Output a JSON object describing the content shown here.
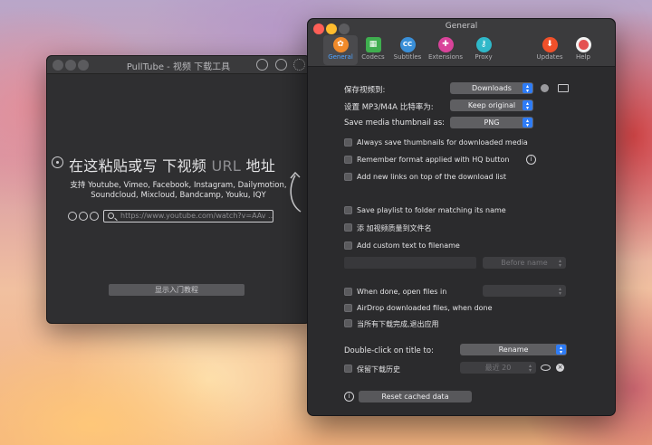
{
  "pulltube": {
    "title": "PullTube - 视频 下载工具",
    "heading_main": "在这粘贴或写 下视频",
    "heading_url": "URL",
    "heading_end": "地址",
    "support_line1": "支持 Youtube, Vimeo, Facebook, Instagram, Dailymotion,",
    "support_line2": "Soundcloud, Mixcloud, Bandcamp, Youku, IQY",
    "url_placeholder": "https://www.youtube.com/watch?v=AAv ...",
    "tutorial_button": "显示入门教程"
  },
  "general": {
    "title": "General",
    "tabs": [
      {
        "label": "General",
        "icon": "gear-icon",
        "color": "#f08a2a"
      },
      {
        "label": "Codecs",
        "icon": "film-icon",
        "color": "#3fae4f"
      },
      {
        "label": "Subtitles",
        "icon": "cc-icon",
        "color": "#3a8fd8"
      },
      {
        "label": "Extensions",
        "icon": "puzzle-icon",
        "color": "#d9439a"
      },
      {
        "label": "Proxy",
        "icon": "key-icon",
        "color": "#2fb8c9"
      },
      {
        "label": "Updates",
        "icon": "download-arrow-icon",
        "color": "#f0502a"
      },
      {
        "label": "Help",
        "icon": "lifebuoy-icon",
        "color": "#e45151"
      }
    ],
    "save_to_label": "保存视频到:",
    "save_to_value": "Downloads",
    "bitrate_label": "设置 MP3/M4A 比特率为:",
    "bitrate_value": "Keep original",
    "thumb_format_label": "Save media thumbnail as:",
    "thumb_format_value": "PNG",
    "checks": {
      "always_thumbs": "Always save thumbnails for downloaded media",
      "remember_format": "Remember format applied with HQ button",
      "new_links_top": "Add new links on top of the download list",
      "playlist_folder": "Save playlist to folder matching its name",
      "quality_filename": "添 加视频质量到文件名",
      "custom_text": "Add custom text to filename",
      "open_files": "When done, open files in",
      "airdrop": "AirDrop downloaded files, when done",
      "quit_app": "当所有下载完成,退出应用",
      "history": "保留下载历史"
    },
    "before_name_value": "Before name",
    "double_click_label": "Double-click on title to:",
    "double_click_value": "Rename",
    "history_value": "最近 20",
    "reset_button": "Reset cached data"
  }
}
